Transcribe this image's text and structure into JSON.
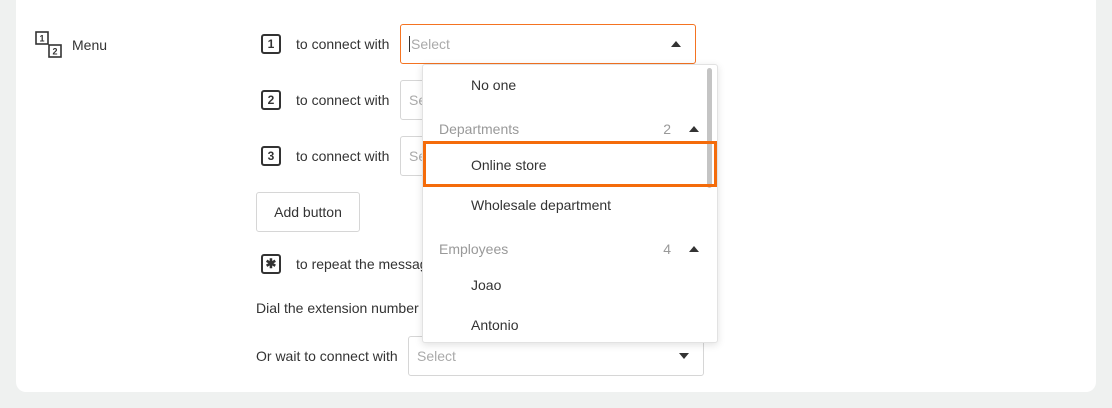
{
  "menu": {
    "label": "Menu",
    "icon": "keypad-icon"
  },
  "rows": [
    {
      "key": "1",
      "text": "to connect with",
      "select_placeholder": "Select"
    },
    {
      "key": "2",
      "text": "to connect with",
      "select_placeholder": "Se"
    },
    {
      "key": "3",
      "text": "to connect with",
      "select_placeholder": "Se"
    }
  ],
  "add_button": {
    "label": "Add button"
  },
  "repeat_row": {
    "key": "✱",
    "text": "to repeat the messag"
  },
  "dial_text": "Dial the extension number",
  "wait": {
    "label": "Or wait to connect with",
    "select_placeholder": "Select"
  },
  "dropdown": {
    "top_item": "No one",
    "groups": [
      {
        "title": "Departments",
        "count": "2",
        "items": [
          "Online store",
          "Wholesale department"
        ]
      },
      {
        "title": "Employees",
        "count": "4",
        "items": [
          "Joao",
          "Antonio"
        ]
      }
    ],
    "highlighted_item": "Online store"
  },
  "colors": {
    "accent": "#f47321",
    "highlight": "#f46b0a",
    "background": "#eff1f0"
  }
}
